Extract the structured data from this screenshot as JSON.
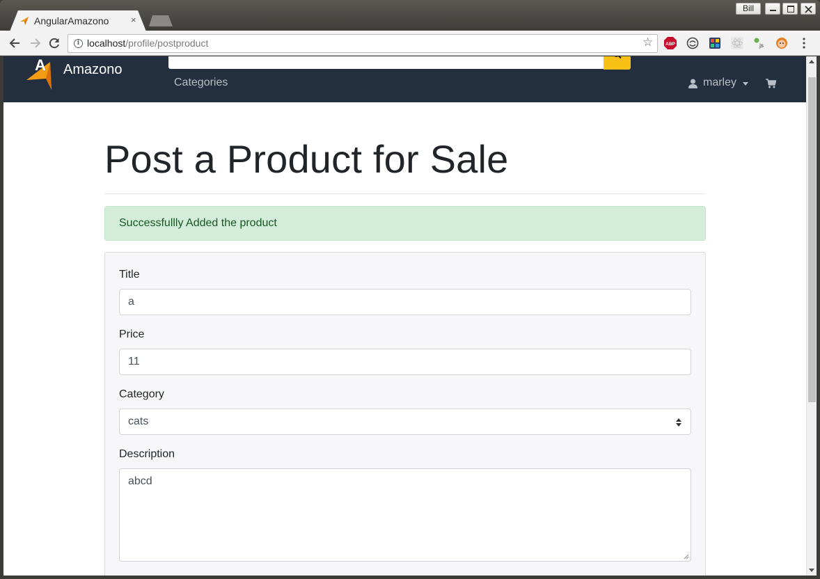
{
  "browser": {
    "tab_title": "AngularAmazono",
    "tab_close": "×",
    "window_user": "Bill",
    "url_host": "localhost",
    "url_path": "/profile/postproduct",
    "extensions": [
      "adblock-plus-icon",
      "sync-icon",
      "color-palette-icon",
      "react-devtools-icon",
      "js-settings-icon",
      "profile-avatar-icon"
    ]
  },
  "navbar": {
    "brand": "Amazono",
    "categories_label": "Categories",
    "user_name": "marley",
    "brand_color": "#232f3e",
    "accent_color": "#f9c015"
  },
  "page": {
    "title": "Post a Product for Sale",
    "alert_message": "Successfullly Added the product",
    "alert_color": "#d4edda"
  },
  "form": {
    "title_label": "Title",
    "title_value": "a",
    "price_label": "Price",
    "price_value": "11",
    "category_label": "Category",
    "category_value": "cats",
    "description_label": "Description",
    "description_value": "abcd"
  }
}
